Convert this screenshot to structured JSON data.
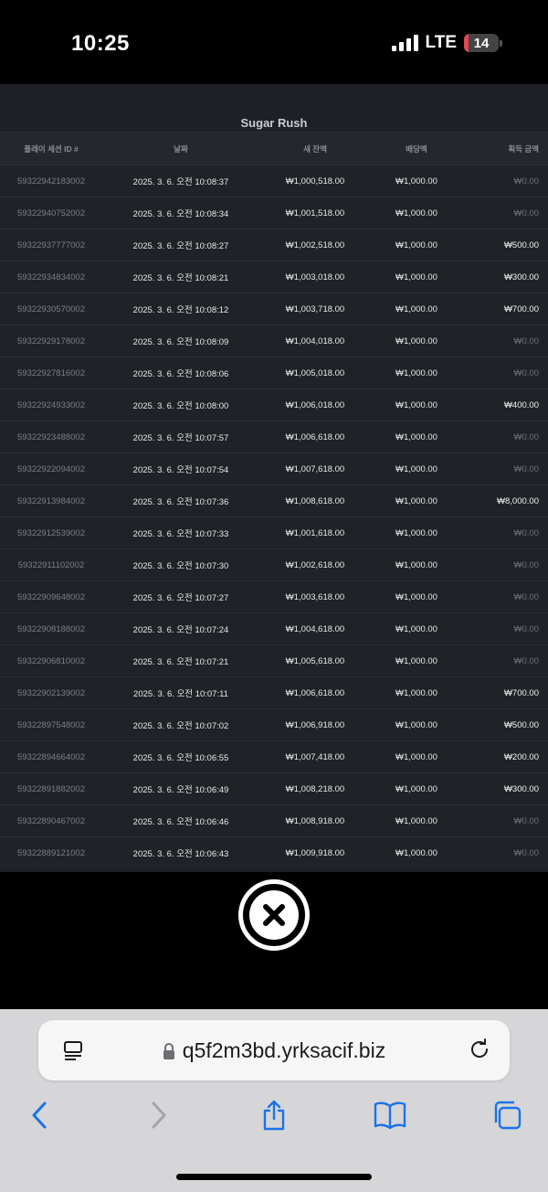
{
  "status": {
    "time": "10:25",
    "network": "LTE",
    "battery_level": 14,
    "battery_color": "#e5484d"
  },
  "panel": {
    "title": "Sugar Rush",
    "columns": [
      "플레이 세션 ID #",
      "날짜",
      "새 잔액",
      "배당액",
      "획득 금액"
    ],
    "rows": [
      [
        "59322942183002",
        "2025. 3. 6. 오전 10:08:37",
        "₩1,000,518.00",
        "₩1,000.00",
        "₩0.00"
      ],
      [
        "59322940752002",
        "2025. 3. 6. 오전 10:08:34",
        "₩1,001,518.00",
        "₩1,000.00",
        "₩0.00"
      ],
      [
        "59322937777002",
        "2025. 3. 6. 오전 10:08:27",
        "₩1,002,518.00",
        "₩1,000.00",
        "₩500.00"
      ],
      [
        "59322934834002",
        "2025. 3. 6. 오전 10:08:21",
        "₩1,003,018.00",
        "₩1,000.00",
        "₩300.00"
      ],
      [
        "59322930570002",
        "2025. 3. 6. 오전 10:08:12",
        "₩1,003,718.00",
        "₩1,000.00",
        "₩700.00"
      ],
      [
        "59322929178002",
        "2025. 3. 6. 오전 10:08:09",
        "₩1,004,018.00",
        "₩1,000.00",
        "₩0.00"
      ],
      [
        "59322927816002",
        "2025. 3. 6. 오전 10:08:06",
        "₩1,005,018.00",
        "₩1,000.00",
        "₩0.00"
      ],
      [
        "59322924933002",
        "2025. 3. 6. 오전 10:08:00",
        "₩1,006,018.00",
        "₩1,000.00",
        "₩400.00"
      ],
      [
        "59322923488002",
        "2025. 3. 6. 오전 10:07:57",
        "₩1,006,618.00",
        "₩1,000.00",
        "₩0.00"
      ],
      [
        "59322922094002",
        "2025. 3. 6. 오전 10:07:54",
        "₩1,007,618.00",
        "₩1,000.00",
        "₩0.00"
      ],
      [
        "59322913984002",
        "2025. 3. 6. 오전 10:07:36",
        "₩1,008,618.00",
        "₩1,000.00",
        "₩8,000.00"
      ],
      [
        "59322912539002",
        "2025. 3. 6. 오전 10:07:33",
        "₩1,001,618.00",
        "₩1,000.00",
        "₩0.00"
      ],
      [
        "59322911102002",
        "2025. 3. 6. 오전 10:07:30",
        "₩1,002,618.00",
        "₩1,000.00",
        "₩0.00"
      ],
      [
        "59322909648002",
        "2025. 3. 6. 오전 10:07:27",
        "₩1,003,618.00",
        "₩1,000.00",
        "₩0.00"
      ],
      [
        "59322908188002",
        "2025. 3. 6. 오전 10:07:24",
        "₩1,004,618.00",
        "₩1,000.00",
        "₩0.00"
      ],
      [
        "59322906810002",
        "2025. 3. 6. 오전 10:07:21",
        "₩1,005,618.00",
        "₩1,000.00",
        "₩0.00"
      ],
      [
        "59322902139002",
        "2025. 3. 6. 오전 10:07:11",
        "₩1,006,618.00",
        "₩1,000.00",
        "₩700.00"
      ],
      [
        "59322897548002",
        "2025. 3. 6. 오전 10:07:02",
        "₩1,006,918.00",
        "₩1,000.00",
        "₩500.00"
      ],
      [
        "59322894664002",
        "2025. 3. 6. 오전 10:06:55",
        "₩1,007,418.00",
        "₩1,000.00",
        "₩200.00"
      ],
      [
        "59322891882002",
        "2025. 3. 6. 오전 10:06:49",
        "₩1,008,218.00",
        "₩1,000.00",
        "₩300.00"
      ],
      [
        "59322890467002",
        "2025. 3. 6. 오전 10:06:46",
        "₩1,008,918.00",
        "₩1,000.00",
        "₩0.00"
      ],
      [
        "59322889121002",
        "2025. 3. 6. 오전 10:06:43",
        "₩1,009,918.00",
        "₩1,000.00",
        "₩0.00"
      ]
    ]
  },
  "browser": {
    "url": "q5f2m3bd.yrksacif.biz",
    "accent_color": "#1a73e8"
  }
}
